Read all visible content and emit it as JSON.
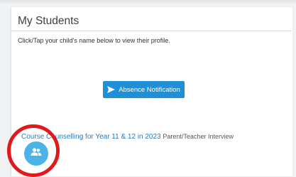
{
  "header": {
    "title": "My Students"
  },
  "main": {
    "instruction": "Click/Tap your child's name below to view their profile.",
    "absence_button_label": "Absence Notification",
    "event": {
      "title": "Course Counselling for Year 11 & 12 in 2023",
      "type": "Parent/Teacher Interview"
    }
  },
  "icons": {
    "absence_button": "send-icon",
    "fab": "group-icon"
  },
  "colors": {
    "accent": "#1f90d8",
    "fab": "#4ab3e8",
    "link": "#2a7ab8",
    "highlight_ring": "#e01a1a"
  }
}
